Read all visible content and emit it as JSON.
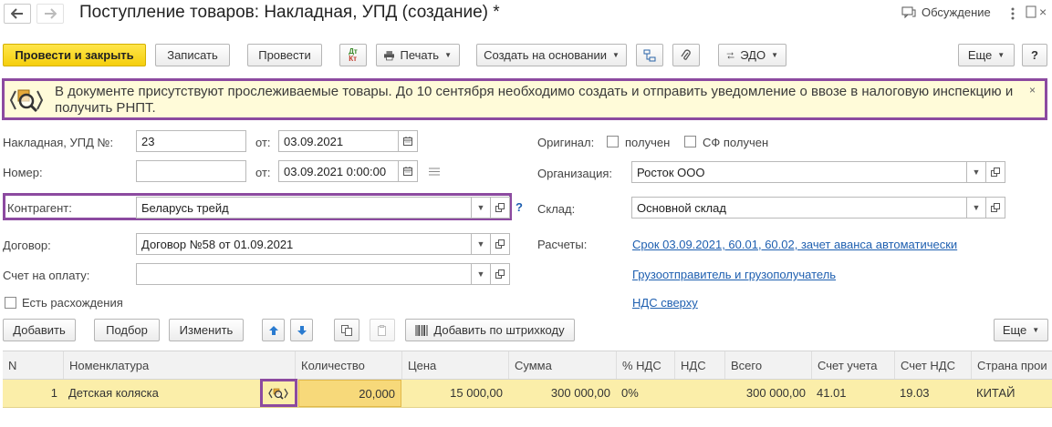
{
  "window": {
    "title": "Поступление товаров: Накладная, УПД (создание) *",
    "discussion_label": "Обсуждение"
  },
  "toolbar": {
    "post_close": "Провести и закрыть",
    "save": "Записать",
    "post": "Провести",
    "dt_kt": "Дт/Кт",
    "print": "Печать",
    "create_based": "Создать на основании",
    "edo": "ЭДО",
    "more": "Еще",
    "help": "?"
  },
  "warning": {
    "text": "В документе присутствуют прослеживаемые товары. До 10 сентября необходимо создать и отправить уведомление о ввозе в налоговую инспекцию и получить РНПТ.",
    "close": "×"
  },
  "form": {
    "invoice_label": "Накладная, УПД №:",
    "invoice_number": "23",
    "from_label": "от:",
    "invoice_date": "03.09.2021",
    "number_label": "Номер:",
    "number_value": "",
    "from_label2": "от:",
    "number_date": "03.09.2021  0:00:00",
    "contractor_label": "Контрагент:",
    "contractor_value": "Беларусь трейд",
    "contract_label": "Договор:",
    "contract_value": "Договор №58 от 01.09.2021",
    "payment_invoice_label": "Счет на оплату:",
    "payment_invoice_value": "",
    "discrepancies_label": "Есть расхождения",
    "original_label": "Оригинал:",
    "original_received": "получен",
    "sf_received": "СФ получен",
    "org_label": "Организация:",
    "org_value": "Росток ООО",
    "warehouse_label": "Склад:",
    "warehouse_value": "Основной склад",
    "settlements_label": "Расчеты:",
    "settlements_link": "Срок 03.09.2021, 60.01, 60.02, зачет аванса автоматически",
    "shipper_link": "Грузоотправитель и грузополучатель",
    "vat_link": "НДС сверху"
  },
  "table_toolbar": {
    "add": "Добавить",
    "pick": "Подбор",
    "change": "Изменить",
    "add_barcode": "Добавить по штрихкоду",
    "more": "Еще"
  },
  "table": {
    "columns": [
      "N",
      "Номенклатура",
      "Количество",
      "Цена",
      "Сумма",
      "% НДС",
      "НДС",
      "Всего",
      "Счет учета",
      "Счет НДС",
      "Страна прои"
    ],
    "rows": [
      [
        "1",
        "Детская коляска",
        "20,000",
        "15 000,00",
        "300 000,00",
        "0%",
        "",
        "300 000,00",
        "41.01",
        "19.03",
        "КИТАЙ"
      ]
    ]
  },
  "colors": {
    "accent_highlight": "#8c4aa0",
    "primary_button": "#f5cf0c",
    "warning_bg": "#fffbd9",
    "selected_row": "#fbeea9",
    "link": "#1e5fb0"
  }
}
